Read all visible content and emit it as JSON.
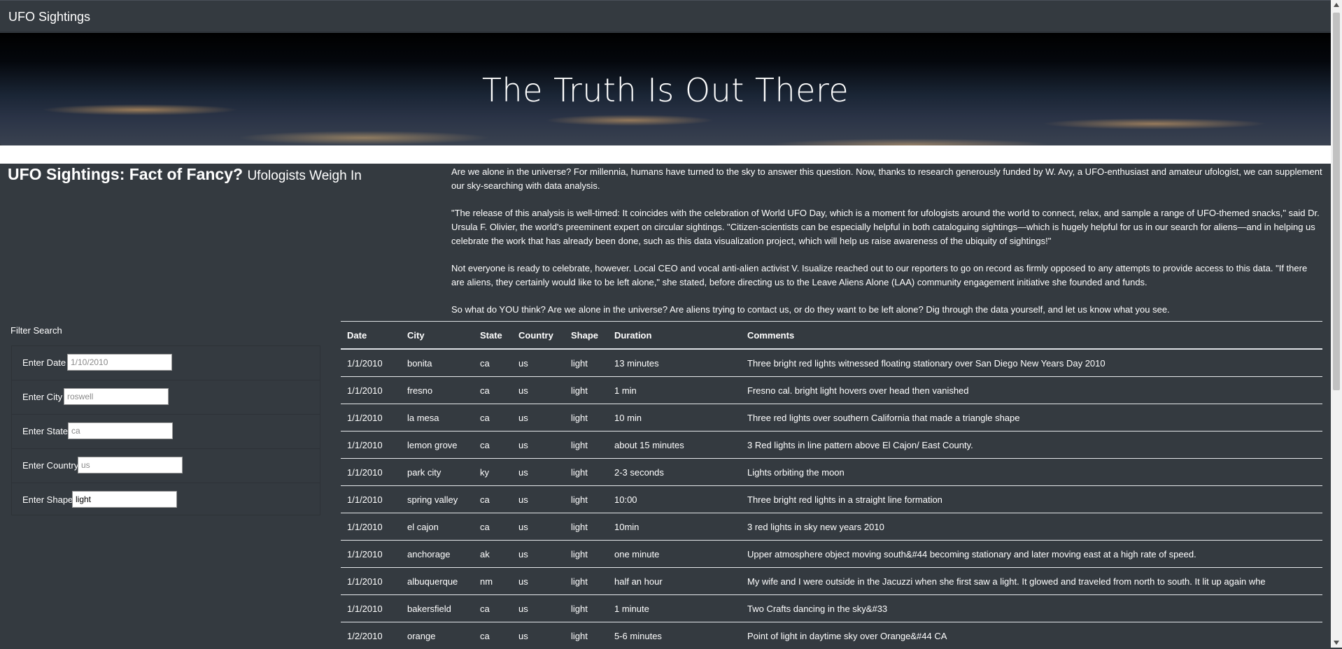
{
  "navbar": {
    "brand": "UFO Sightings"
  },
  "hero": {
    "title": "The Truth Is Out There"
  },
  "article": {
    "heading": "UFO Sightings: Fact of Fancy?",
    "subheading": "Ufologists Weigh In",
    "paragraphs": [
      "Are we alone in the universe? For millennia, humans have turned to the sky to answer this question. Now, thanks to research generously funded by W. Avy, a UFO-enthusiast and amateur ufologist, we can supplement our sky-searching with data analysis.",
      "\"The release of this analysis is well-timed: It coincides with the celebration of World UFO Day, which is a moment for ufologists around the world to connect, relax, and sample a range of UFO-themed snacks,\" said Dr. Ursula F. Olivier, the world's preeminent expert on circular sightings. \"Citizen-scientists can be especially helpful in both cataloguing sightings—which is hugely helpful for us in our search for aliens—and in helping us celebrate the work that has already been done, such as this data visualization project, which will help us raise awareness of the ubiquity of sightings!\"",
      "Not everyone is ready to celebrate, however. Local CEO and vocal anti-alien activist V. Isualize reached out to our reporters to go on record as firmly opposed to any attempts to provide access to this data. \"If there are aliens, they certainly would like to be left alone,\" she stated, before directing us to the Leave Aliens Alone (LAA) community engagement initiative she founded and funds.",
      "So what do YOU think? Are we alone in the universe? Are aliens trying to contact us, or do they want to be left alone? Dig through the data yourself, and let us know what you see."
    ]
  },
  "filters": {
    "title": "Filter Search",
    "date": {
      "label": "Enter Date",
      "placeholder": "1/10/2010",
      "value": ""
    },
    "city": {
      "label": "Enter City",
      "placeholder": "roswell",
      "value": ""
    },
    "state": {
      "label": "Enter State",
      "placeholder": "ca",
      "value": ""
    },
    "country": {
      "label": "Enter Country",
      "placeholder": "us",
      "value": ""
    },
    "shape": {
      "label": "Enter Shape",
      "placeholder": "",
      "value": "light"
    }
  },
  "table": {
    "headers": [
      "Date",
      "City",
      "State",
      "Country",
      "Shape",
      "Duration",
      "Comments"
    ],
    "rows": [
      [
        "1/1/2010",
        "bonita",
        "ca",
        "us",
        "light",
        "13 minutes",
        "Three bright red lights witnessed floating stationary over San Diego New Years Day 2010"
      ],
      [
        "1/1/2010",
        "fresno",
        "ca",
        "us",
        "light",
        "1 min",
        "Fresno cal. bright light hovers over head then vanished"
      ],
      [
        "1/1/2010",
        "la mesa",
        "ca",
        "us",
        "light",
        "10 min",
        "Three red lights over southern California that made a triangle shape"
      ],
      [
        "1/1/2010",
        "lemon grove",
        "ca",
        "us",
        "light",
        "about 15 minutes",
        "3 Red lights in line pattern above El Cajon/ East County."
      ],
      [
        "1/1/2010",
        "park city",
        "ky",
        "us",
        "light",
        "2-3 seconds",
        "Lights orbiting the moon"
      ],
      [
        "1/1/2010",
        "spring valley",
        "ca",
        "us",
        "light",
        "10:00",
        "Three bright red lights in a straight line formation"
      ],
      [
        "1/1/2010",
        "el cajon",
        "ca",
        "us",
        "light",
        "10min",
        "3 red lights in sky new years 2010"
      ],
      [
        "1/1/2010",
        "anchorage",
        "ak",
        "us",
        "light",
        "one minute",
        "Upper atmosphere object moving south&#44 becoming stationary and later moving east at a high rate of speed."
      ],
      [
        "1/1/2010",
        "albuquerque",
        "nm",
        "us",
        "light",
        "half an hour",
        "My wife and I were outside in the Jacuzzi when she first saw a light. It glowed and traveled from north to south. It lit up again whe"
      ],
      [
        "1/1/2010",
        "bakersfield",
        "ca",
        "us",
        "light",
        "1 minute",
        "Two Crafts dancing in the sky&#33"
      ],
      [
        "1/2/2010",
        "orange",
        "ca",
        "us",
        "light",
        "5-6 minutes",
        "Point of light in daytime sky over Orange&#44 CA"
      ]
    ]
  }
}
